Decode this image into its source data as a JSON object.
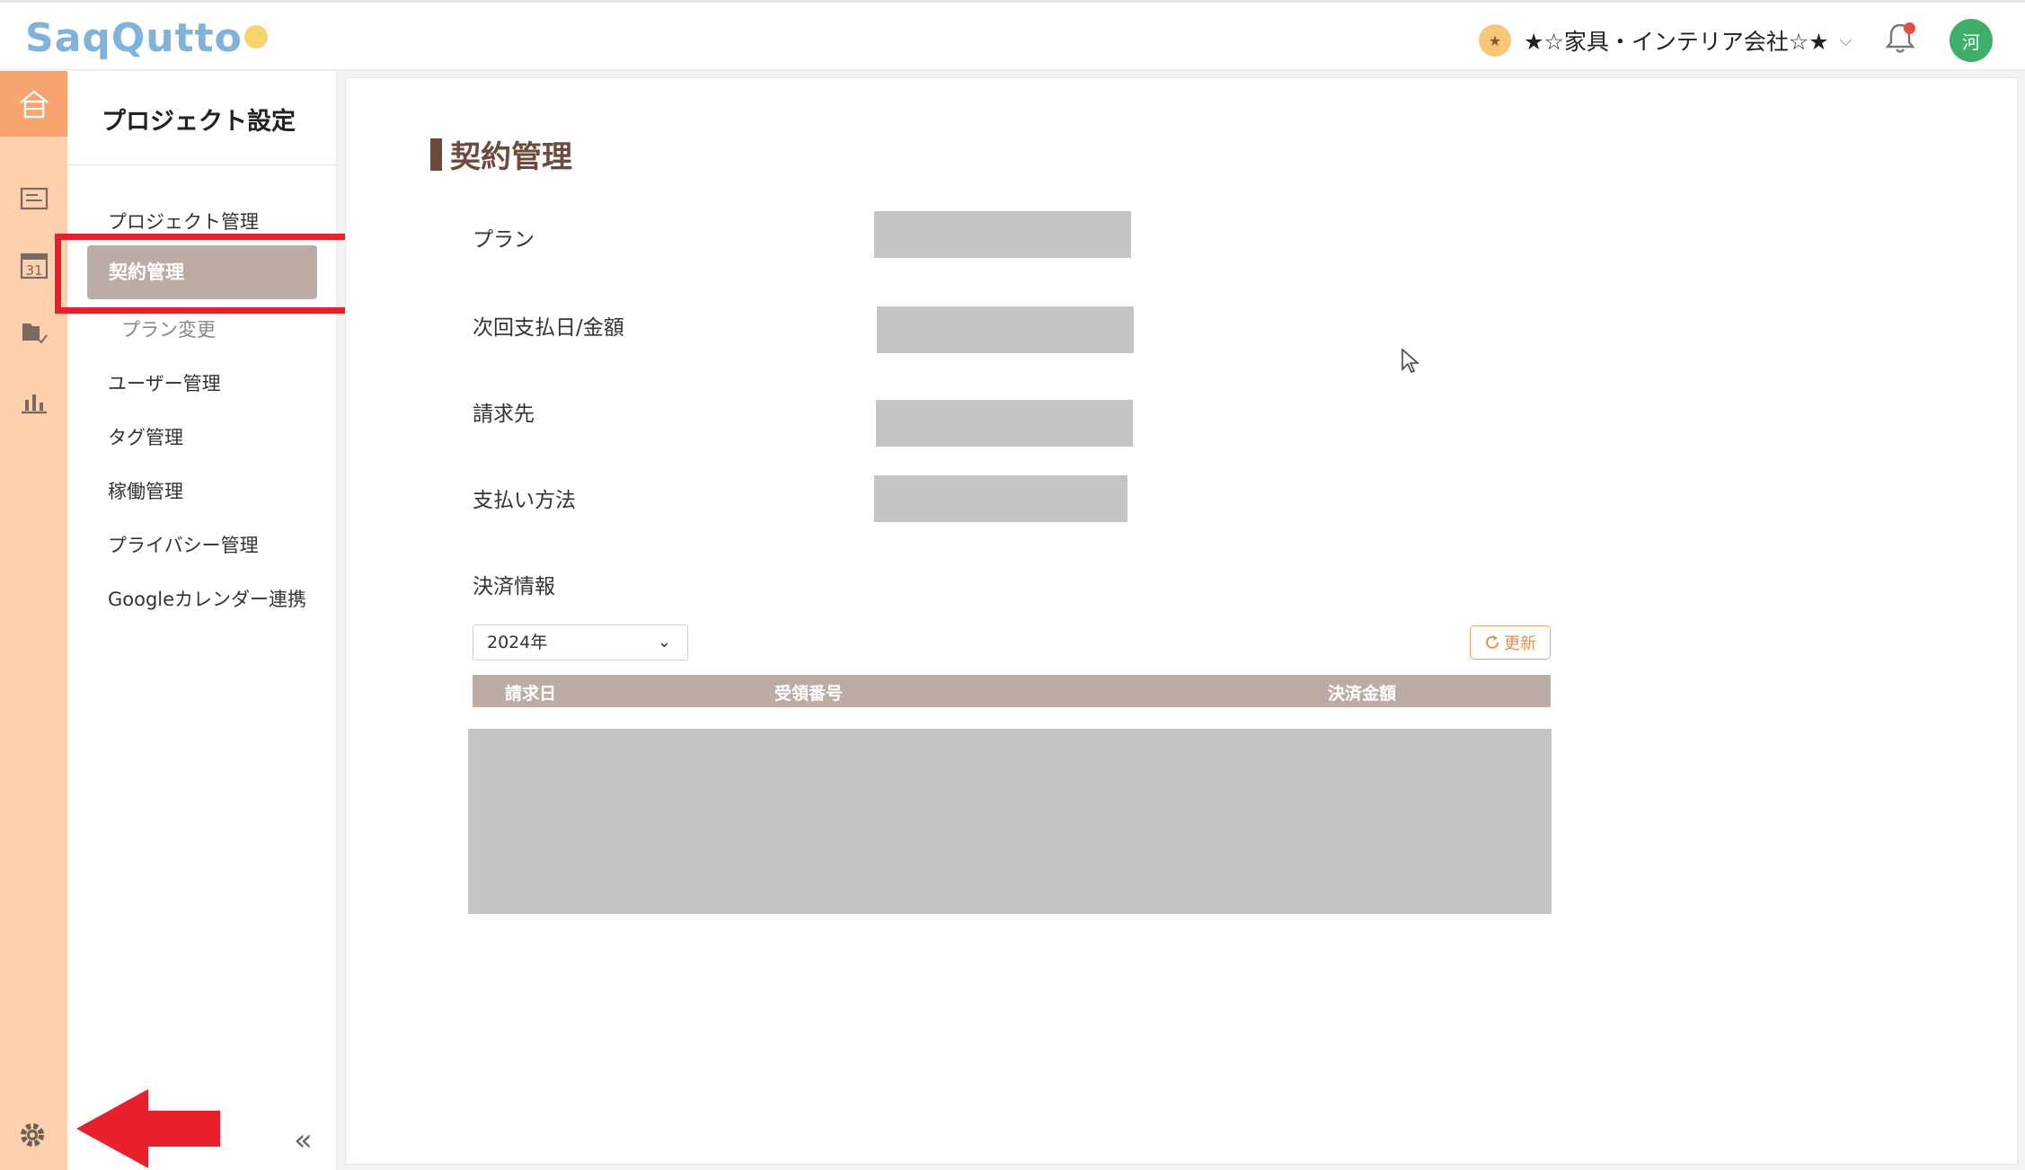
{
  "app": {
    "logo_text": "SaqQutto"
  },
  "header": {
    "company_icon": "star-coin-icon",
    "company_name": "★☆家具・インテリア会社☆★",
    "notification_icon": "bell-icon",
    "avatar_initial": "河",
    "avatar_color": "#3fae6a"
  },
  "rail": {
    "icons": [
      "home-icon",
      "task-list-icon",
      "calendar-icon",
      "folder-icon",
      "chart-icon",
      "gear-icon"
    ],
    "calendar_day": "31"
  },
  "sidebar": {
    "title": "プロジェクト設定",
    "items": [
      {
        "label": "プロジェクト管理"
      },
      {
        "label": "契約管理",
        "active": true
      },
      {
        "label": "プラン変更",
        "sub": true
      },
      {
        "label": "ユーザー管理"
      },
      {
        "label": "タグ管理"
      },
      {
        "label": "稼働管理"
      },
      {
        "label": "プライバシー管理"
      },
      {
        "label": "Googleカレンダー連携"
      }
    ],
    "collapse_label": "«"
  },
  "main": {
    "title": "契約管理",
    "fields": [
      {
        "label": "プラン"
      },
      {
        "label": "次回支払日/金額"
      },
      {
        "label": "請求先"
      },
      {
        "label": "支払い方法"
      }
    ],
    "payment_section": "決済情報",
    "year_select": {
      "value": "2024年"
    },
    "refresh_label": "更新",
    "table": {
      "columns": [
        "請求日",
        "受領番号",
        "決済金額"
      ]
    }
  },
  "colors": {
    "accent": "#f7a46f",
    "rail_bg": "#fdd0ae",
    "active_nav": "#bcaca5",
    "title_brown": "#6e4a3c",
    "annotation_red": "#e8202b"
  }
}
